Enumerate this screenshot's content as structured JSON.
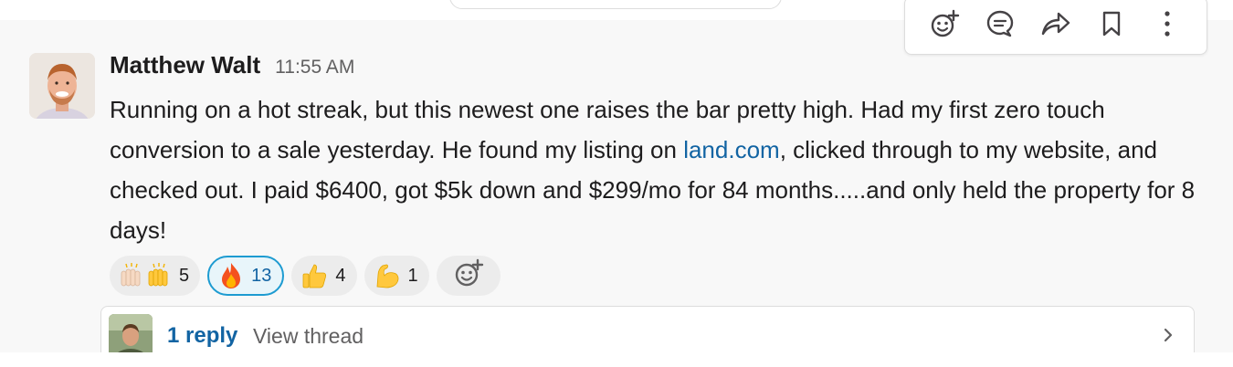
{
  "message": {
    "author": "Matthew Walt",
    "timestamp": "11:55 AM",
    "text_before_link": "Running on a hot streak, but this newest one raises the bar pretty high. Had my first zero touch conversion to a sale yesterday. He found my listing on ",
    "link_text": "land.com",
    "text_after_link": ",  clicked through to my website, and checked out. I paid $6400, got $5k down and $299/mo for 84 months.....and only held the property for 8 days!"
  },
  "reactions": [
    {
      "emoji_name": "raised-hands-icon",
      "count": "5",
      "active": false
    },
    {
      "emoji_name": "fire-icon",
      "count": "13",
      "active": true
    },
    {
      "emoji_name": "thumbs-up-icon",
      "count": "4",
      "active": false
    },
    {
      "emoji_name": "flexed-biceps-icon",
      "count": "1",
      "active": false
    }
  ],
  "thread": {
    "reply_count": "1 reply",
    "view_label": "View thread"
  },
  "toolbar": {
    "icons": [
      "add-reaction-icon",
      "reply-in-thread-icon",
      "share-icon",
      "bookmark-icon",
      "more-actions-icon"
    ]
  },
  "colors": {
    "link": "#1264a3",
    "active_reaction_border": "#1d9bd1",
    "active_reaction_bg": "#e8f5fa",
    "message_bg": "#f8f8f8"
  }
}
